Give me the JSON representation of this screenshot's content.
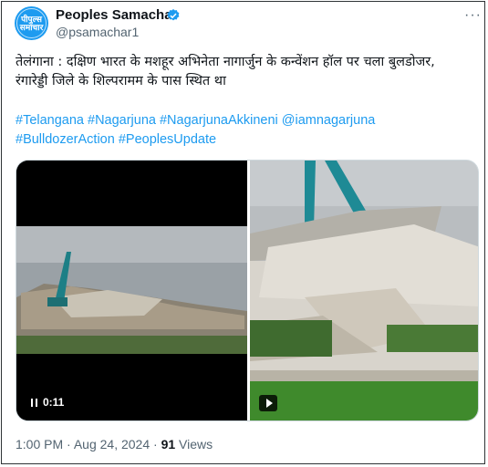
{
  "account": {
    "avatar_text_top": "पीपुल्स",
    "avatar_text_bottom": "समाचार",
    "name": "Peoples Samachar",
    "handle": "@psamachar1",
    "more": "···"
  },
  "tweet": {
    "text_line1": "तेलंगाना : दक्षिण भारत के मशहूर अभिनेता नागार्जुन के कन्वेंशन हॉल पर चला बुलडोजर,",
    "text_line2": "रंगारेड्डी जिले के शिल्परामम के पास स्थित था",
    "hashtags_row1": [
      "#Telangana",
      "#Nagarjuna",
      "#NagarjunaAkkineni",
      "@iamnagarjuna"
    ],
    "hashtags_row2": [
      "#BulldozerAction",
      "#PeoplesUpdate"
    ]
  },
  "media": {
    "video_time": "0:11"
  },
  "meta": {
    "time": "1:00 PM",
    "date": "Aug 24, 2024",
    "separator": "·",
    "views_count": "91",
    "views_label": "Views"
  },
  "colors": {
    "accent": "#1d9bf0",
    "text": "#0f1419",
    "secondary": "#536471"
  }
}
